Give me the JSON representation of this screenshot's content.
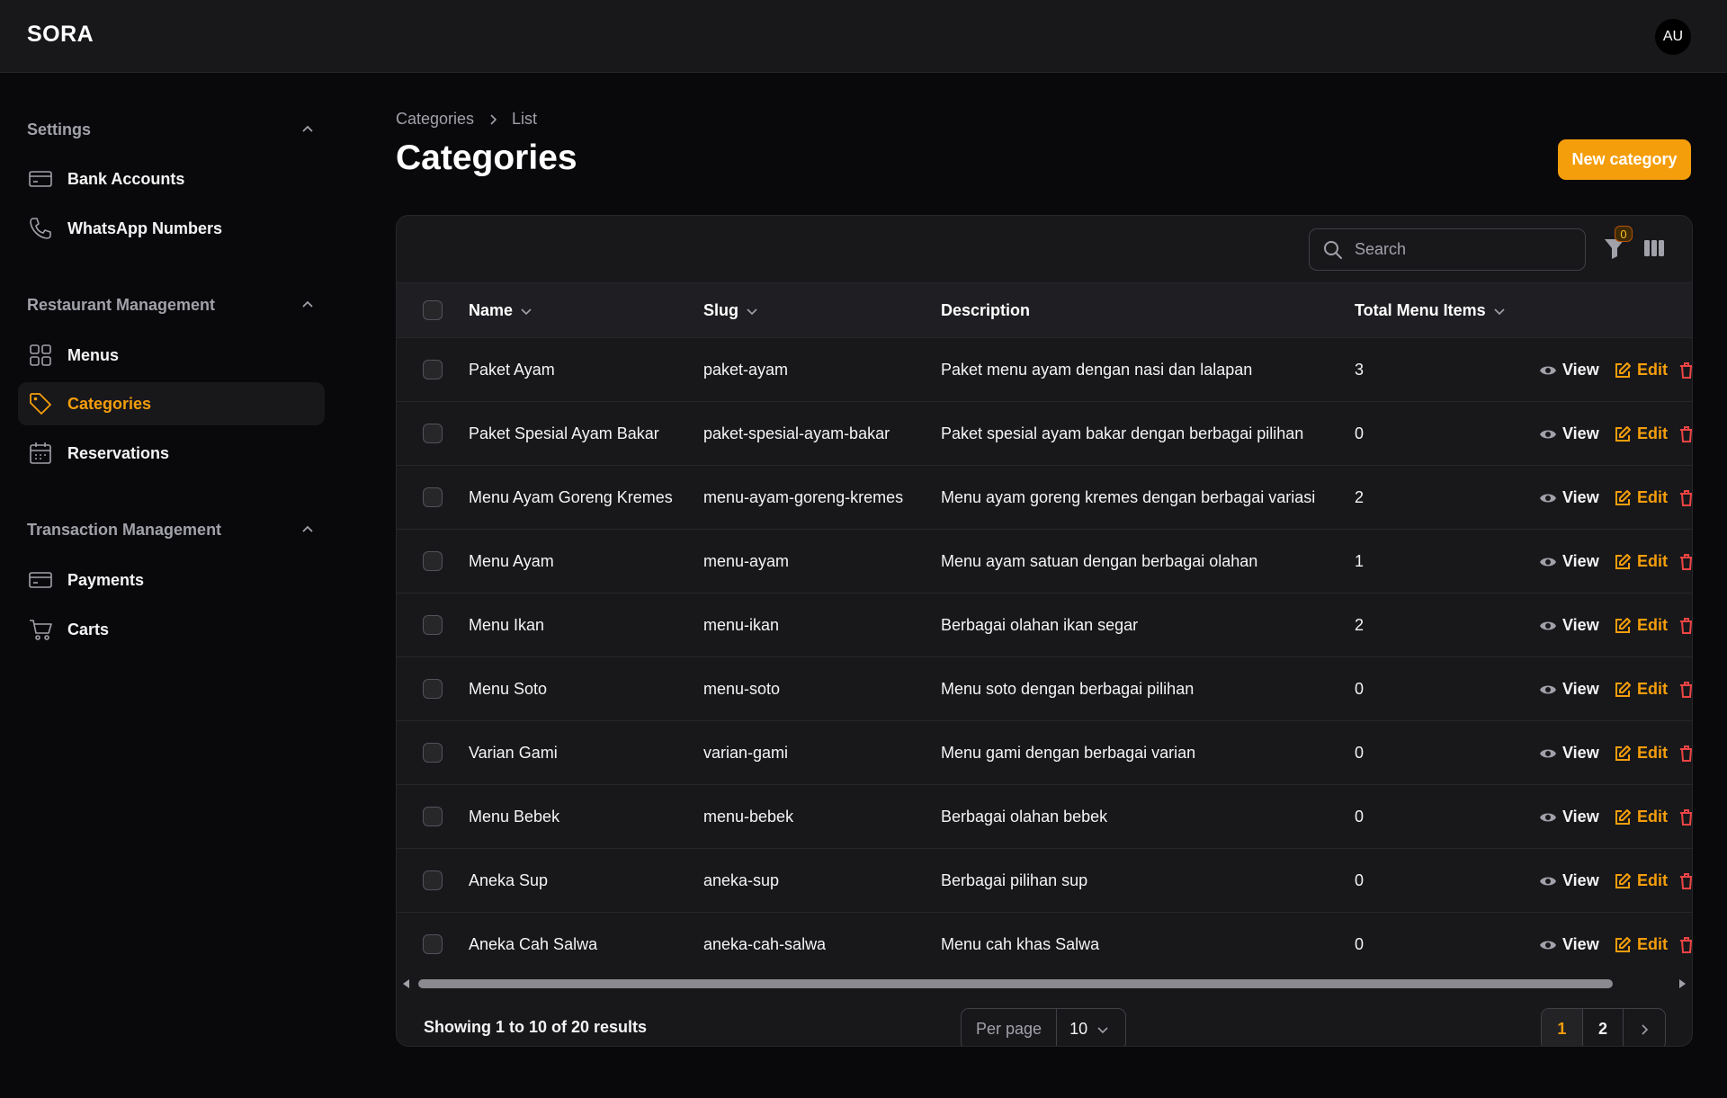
{
  "app": {
    "brand": "SORA",
    "avatar_initials": "AU"
  },
  "colors": {
    "accent": "#f59e0b",
    "danger": "#ef4444",
    "background": "#09090b",
    "surface": "#18181b"
  },
  "sidebar": {
    "groups": [
      {
        "label": "Settings",
        "items": [
          {
            "label": "Bank Accounts",
            "icon": "credit-card-icon"
          },
          {
            "label": "WhatsApp Numbers",
            "icon": "phone-icon"
          }
        ]
      },
      {
        "label": "Restaurant Management",
        "items": [
          {
            "label": "Menus",
            "icon": "grid-icon"
          },
          {
            "label": "Categories",
            "icon": "tag-icon",
            "active": true
          },
          {
            "label": "Reservations",
            "icon": "calendar-icon"
          }
        ]
      },
      {
        "label": "Transaction Management",
        "items": [
          {
            "label": "Payments",
            "icon": "credit-card-icon"
          },
          {
            "label": "Carts",
            "icon": "cart-icon"
          }
        ]
      }
    ]
  },
  "breadcrumb": {
    "items": [
      "Categories",
      "List"
    ]
  },
  "page": {
    "title": "Categories",
    "new_button": "New category"
  },
  "table": {
    "search_placeholder": "Search",
    "filter_count": "0",
    "columns": {
      "name": "Name",
      "slug": "Slug",
      "description": "Description",
      "total": "Total Menu Items"
    },
    "actions": {
      "view": "View",
      "edit": "Edit"
    },
    "rows": [
      {
        "name": "Paket Ayam",
        "slug": "paket-ayam",
        "description": "Paket menu ayam dengan nasi dan lalapan",
        "total": "3"
      },
      {
        "name": "Paket Spesial Ayam Bakar",
        "slug": "paket-spesial-ayam-bakar",
        "description": "Paket spesial ayam bakar dengan berbagai pilihan",
        "total": "0"
      },
      {
        "name": "Menu Ayam Goreng Kremes",
        "slug": "menu-ayam-goreng-kremes",
        "description": "Menu ayam goreng kremes dengan berbagai variasi",
        "total": "2"
      },
      {
        "name": "Menu Ayam",
        "slug": "menu-ayam",
        "description": "Menu ayam satuan dengan berbagai olahan",
        "total": "1"
      },
      {
        "name": "Menu Ikan",
        "slug": "menu-ikan",
        "description": "Berbagai olahan ikan segar",
        "total": "2"
      },
      {
        "name": "Menu Soto",
        "slug": "menu-soto",
        "description": "Menu soto dengan berbagai pilihan",
        "total": "0"
      },
      {
        "name": "Varian Gami",
        "slug": "varian-gami",
        "description": "Menu gami dengan berbagai varian",
        "total": "0"
      },
      {
        "name": "Menu Bebek",
        "slug": "menu-bebek",
        "description": "Berbagai olahan bebek",
        "total": "0"
      },
      {
        "name": "Aneka Sup",
        "slug": "aneka-sup",
        "description": "Berbagai pilihan sup",
        "total": "0"
      },
      {
        "name": "Aneka Cah Salwa",
        "slug": "aneka-cah-salwa",
        "description": "Menu cah khas Salwa",
        "total": "0"
      }
    ]
  },
  "pagination": {
    "summary": "Showing 1 to 10 of 20 results",
    "per_page_label": "Per page",
    "per_page_value": "10",
    "pages": [
      "1",
      "2"
    ],
    "current": "1"
  }
}
